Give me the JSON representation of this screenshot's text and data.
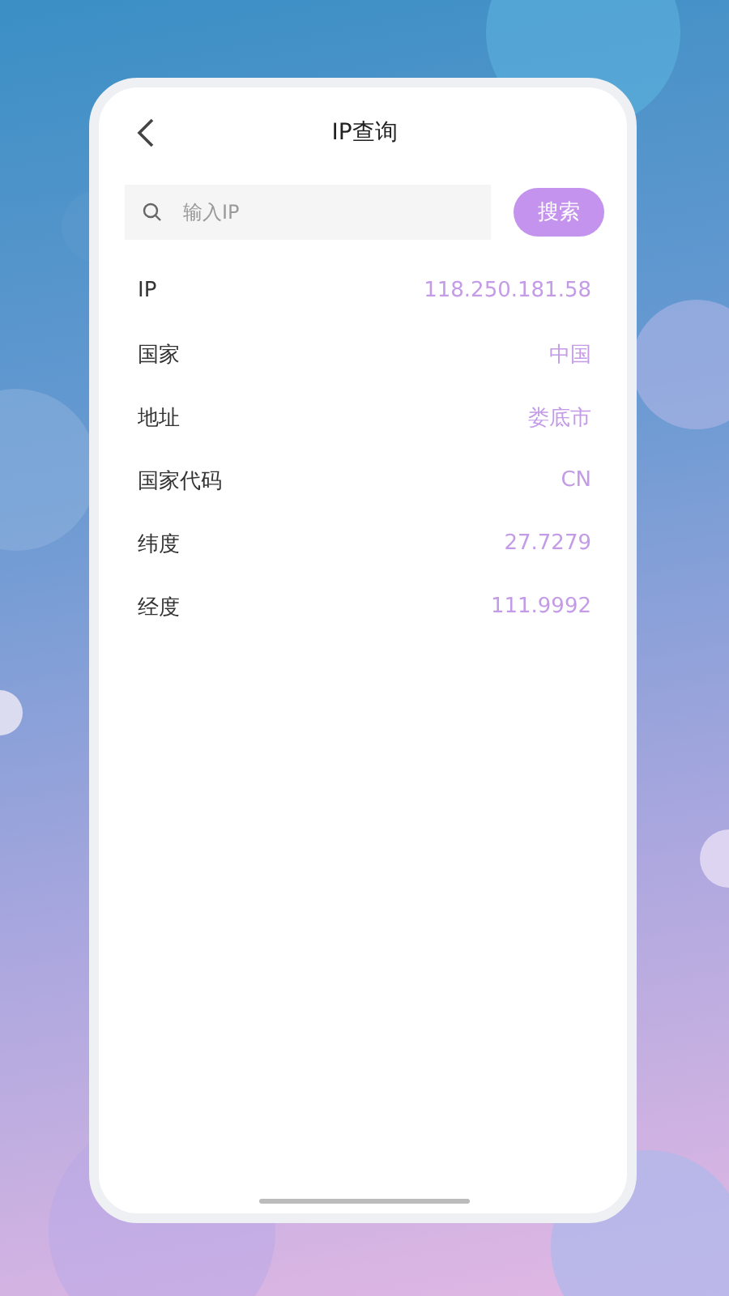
{
  "header": {
    "title": "IP查询"
  },
  "search": {
    "placeholder": "输入IP",
    "button": "搜索"
  },
  "rows": [
    {
      "label": "IP",
      "value": "118.250.181.58"
    },
    {
      "label": "国家",
      "value": "中国"
    },
    {
      "label": "地址",
      "value": "娄底市"
    },
    {
      "label": "国家代码",
      "value": "CN"
    },
    {
      "label": "纬度",
      "value": "27.7279"
    },
    {
      "label": "经度",
      "value": "111.9992"
    }
  ]
}
